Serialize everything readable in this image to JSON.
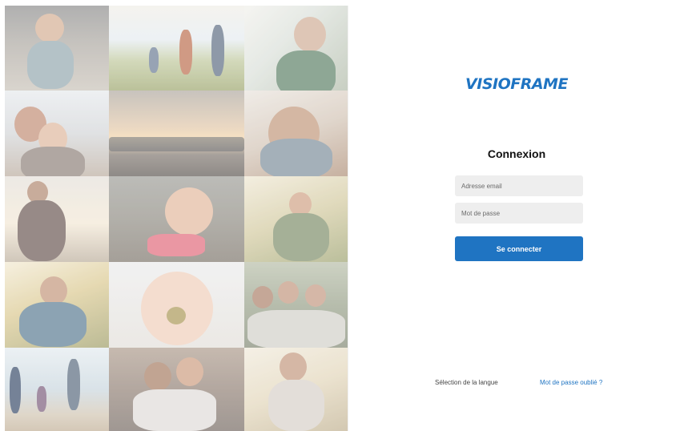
{
  "brand": {
    "name": "VISIOFRAME"
  },
  "login": {
    "title": "Connexion",
    "email_placeholder": "Adresse email",
    "password_placeholder": "Mot de passe",
    "submit_label": "Se connecter"
  },
  "footer": {
    "language_label": "Sélection de la langue",
    "forgot_password_label": "Mot de passe oublié ?"
  },
  "colors": {
    "accent": "#1f74c2",
    "field_background": "#eeeeee"
  },
  "photo_grid": {
    "tiles": [
      "child-with-parent-photo",
      "family-in-field-photo",
      "grandparents-photo",
      "mother-child-beach-photo",
      "group-sunset-beach-photo",
      "child-hug-photo",
      "father-child-sunset-photo",
      "birthday-cake-photo",
      "children-reading-photo",
      "mother-reading-photo",
      "baby-eating-photo",
      "friends-group-photo",
      "beach-walk-photo",
      "kids-hugging-photo",
      "mother-child-outdoor-photo"
    ]
  }
}
